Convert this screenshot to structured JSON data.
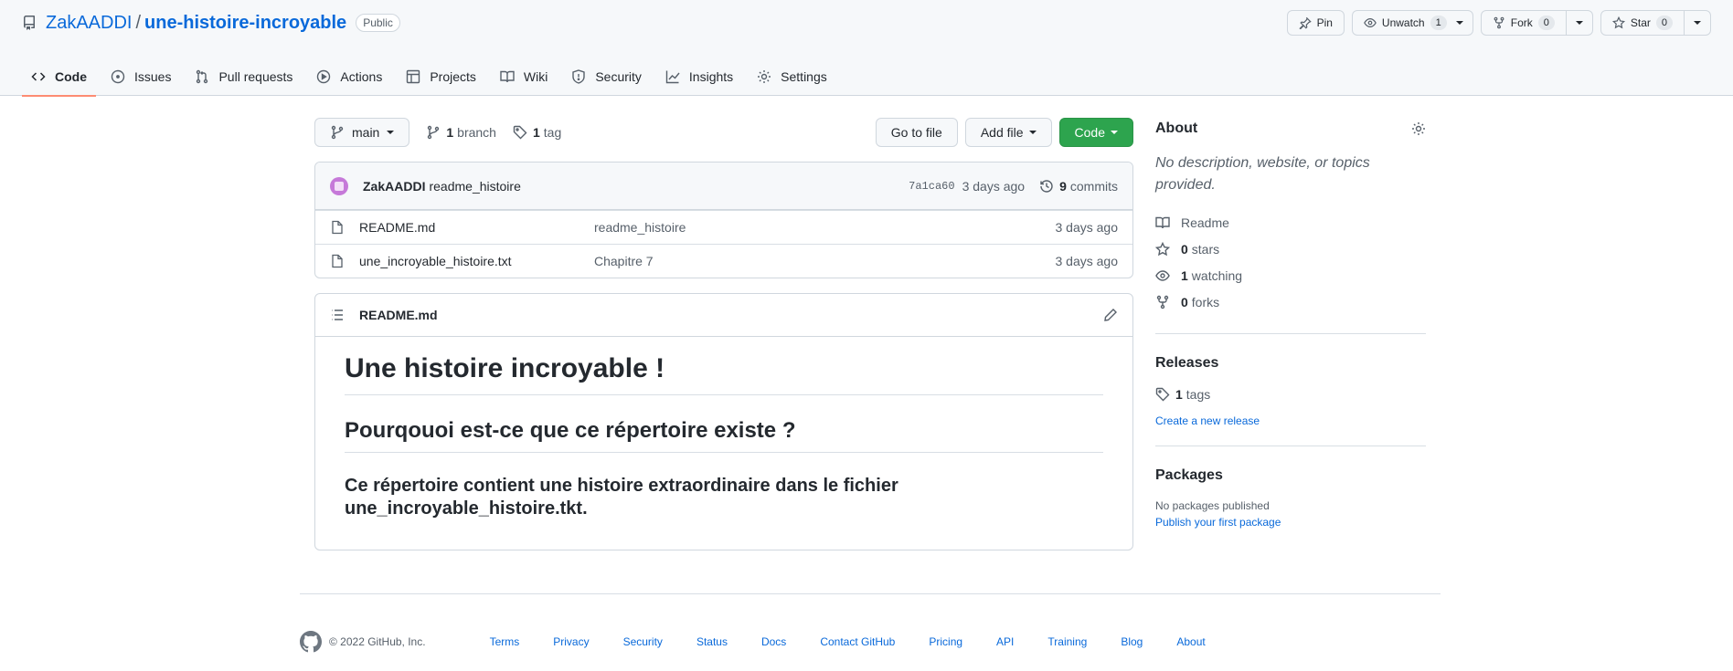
{
  "repo": {
    "owner": "ZakAADDI",
    "separator": "/",
    "name": "une-histoire-incroyable",
    "visibility": "Public"
  },
  "actions": {
    "pin_label": "Pin",
    "unwatch_label": "Unwatch",
    "watch_count": "1",
    "fork_label": "Fork",
    "fork_count": "0",
    "star_label": "Star",
    "star_count": "0"
  },
  "tabs": [
    {
      "label": "Code",
      "icon": "code-icon",
      "active": true
    },
    {
      "label": "Issues",
      "icon": "issue-icon"
    },
    {
      "label": "Pull requests",
      "icon": "pull-request-icon"
    },
    {
      "label": "Actions",
      "icon": "play-icon"
    },
    {
      "label": "Projects",
      "icon": "table-icon"
    },
    {
      "label": "Wiki",
      "icon": "book-icon"
    },
    {
      "label": "Security",
      "icon": "shield-icon"
    },
    {
      "label": "Insights",
      "icon": "graph-icon"
    },
    {
      "label": "Settings",
      "icon": "gear-icon"
    }
  ],
  "toolbar": {
    "branch": "main",
    "branch_count": "1",
    "branch_label": "branch",
    "tag_count": "1",
    "tag_label": "tag",
    "go_to_file": "Go to file",
    "add_file": "Add file",
    "code": "Code"
  },
  "commit": {
    "author": "ZakAADDI",
    "message": "readme_histoire",
    "sha": "7a1ca60",
    "age": "3 days ago",
    "count": "9",
    "count_label": "commits"
  },
  "files": [
    {
      "name": "README.md",
      "message": "readme_histoire",
      "age": "3 days ago"
    },
    {
      "name": "une_incroyable_histoire.txt",
      "message": "Chapitre 7",
      "age": "3 days ago"
    }
  ],
  "readme": {
    "filename": "README.md",
    "h1": "Une histoire incroyable !",
    "h2": "Pourqouoi est-ce que ce répertoire existe ?",
    "h3": "Ce répertoire contient une histoire extraordinaire dans le fichier une_incroyable_histoire.tkt."
  },
  "sidebar": {
    "about_title": "About",
    "about_desc": "No description, website, or topics provided.",
    "readme_label": "Readme",
    "stars_count": "0",
    "stars_label": "stars",
    "watching_count": "1",
    "watching_label": "watching",
    "forks_count": "0",
    "forks_label": "forks",
    "releases_title": "Releases",
    "tags_count": "1",
    "tags_label": "tags",
    "create_release": "Create a new release",
    "packages_title": "Packages",
    "no_packages": "No packages published",
    "publish_package": "Publish your first package"
  },
  "footer": {
    "copyright": "© 2022 GitHub, Inc.",
    "links": [
      "Terms",
      "Privacy",
      "Security",
      "Status",
      "Docs",
      "Contact GitHub",
      "Pricing",
      "API",
      "Training",
      "Blog",
      "About"
    ]
  },
  "colors": {
    "link": "#0969da",
    "primary_button": "#2da44e",
    "active_tab_underline": "#fd8c73",
    "avatar": "#c679d9"
  }
}
